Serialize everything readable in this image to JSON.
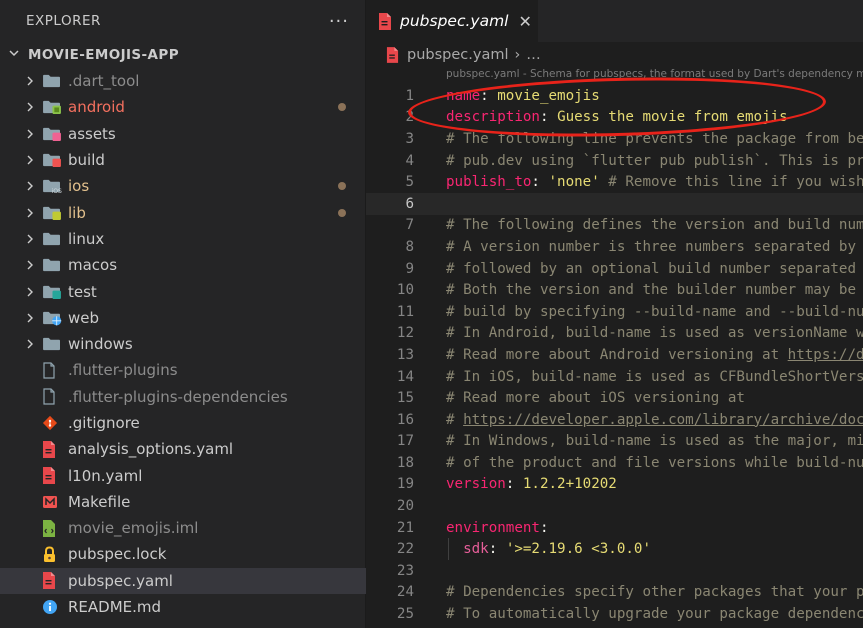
{
  "sidebar": {
    "title": "EXPLORER",
    "more_label": "···",
    "project": "MOVIE-EMOJIS-APP",
    "items": [
      {
        "name": ".dart_tool",
        "kind": "folder",
        "icon": "folder-icon",
        "color": "dim",
        "chevron": true,
        "dot": false
      },
      {
        "name": "android",
        "kind": "folder",
        "icon": "android-folder-icon",
        "color": "red",
        "chevron": true,
        "dot": true
      },
      {
        "name": "assets",
        "kind": "folder",
        "icon": "assets-folder-icon",
        "color": "default",
        "chevron": true,
        "dot": false
      },
      {
        "name": "build",
        "kind": "folder",
        "icon": "build-folder-icon",
        "color": "default",
        "chevron": true,
        "dot": false
      },
      {
        "name": "ios",
        "kind": "folder",
        "icon": "ios-folder-icon",
        "color": "yellow",
        "chevron": true,
        "dot": true
      },
      {
        "name": "lib",
        "kind": "folder",
        "icon": "lib-folder-icon",
        "color": "yellow",
        "chevron": true,
        "dot": true
      },
      {
        "name": "linux",
        "kind": "folder",
        "icon": "folder-icon",
        "color": "default",
        "chevron": true,
        "dot": false
      },
      {
        "name": "macos",
        "kind": "folder",
        "icon": "folder-icon",
        "color": "default",
        "chevron": true,
        "dot": false
      },
      {
        "name": "test",
        "kind": "folder",
        "icon": "test-folder-icon",
        "color": "default",
        "chevron": true,
        "dot": false
      },
      {
        "name": "web",
        "kind": "folder",
        "icon": "web-folder-icon",
        "color": "default",
        "chevron": true,
        "dot": false
      },
      {
        "name": "windows",
        "kind": "folder",
        "icon": "folder-icon",
        "color": "default",
        "chevron": true,
        "dot": false
      },
      {
        "name": ".flutter-plugins",
        "kind": "file",
        "icon": "file-icon",
        "color": "dim",
        "chevron": false,
        "dot": false
      },
      {
        "name": ".flutter-plugins-dependencies",
        "kind": "file",
        "icon": "file-icon",
        "color": "dim",
        "chevron": false,
        "dot": false
      },
      {
        "name": ".gitignore",
        "kind": "file",
        "icon": "git-icon",
        "color": "default",
        "chevron": false,
        "dot": false
      },
      {
        "name": "analysis_options.yaml",
        "kind": "file",
        "icon": "yaml-file-icon",
        "color": "default",
        "chevron": false,
        "dot": false
      },
      {
        "name": "l10n.yaml",
        "kind": "file",
        "icon": "yaml-file-icon",
        "color": "default",
        "chevron": false,
        "dot": false
      },
      {
        "name": "Makefile",
        "kind": "file",
        "icon": "makefile-icon",
        "color": "default",
        "chevron": false,
        "dot": false
      },
      {
        "name": "movie_emojis.iml",
        "kind": "file",
        "icon": "iml-file-icon",
        "color": "dim",
        "chevron": false,
        "dot": false
      },
      {
        "name": "pubspec.lock",
        "kind": "file",
        "icon": "lock-icon",
        "color": "default",
        "chevron": false,
        "dot": false
      },
      {
        "name": "pubspec.yaml",
        "kind": "file",
        "icon": "yaml-file-icon",
        "color": "default",
        "chevron": false,
        "dot": false,
        "selected": true
      },
      {
        "name": "README.md",
        "kind": "file",
        "icon": "info-icon",
        "color": "default",
        "chevron": false,
        "dot": false
      }
    ]
  },
  "editor": {
    "tab_label": "pubspec.yaml",
    "tab_close": "✕",
    "breadcrumb": {
      "file": "pubspec.yaml",
      "sep": "›",
      "more": "…"
    },
    "schema_hint": "pubspec.yaml - Schema for pubspecs, the format used by Dart's dependency manager",
    "current_line": 6,
    "lines": [
      {
        "n": "1",
        "tokens": [
          {
            "t": "name",
            "c": "key"
          },
          {
            "t": ": ",
            "c": "plain"
          },
          {
            "t": "movie_emojis",
            "c": "str"
          }
        ]
      },
      {
        "n": "2",
        "tokens": [
          {
            "t": "description",
            "c": "key"
          },
          {
            "t": ": ",
            "c": "plain"
          },
          {
            "t": "Guess the movie from emojis",
            "c": "str"
          }
        ]
      },
      {
        "n": "3",
        "tokens": [
          {
            "t": "# The following line prevents the package from being accidentally published to",
            "c": "com"
          }
        ]
      },
      {
        "n": "4",
        "tokens": [
          {
            "t": "# pub.dev using `flutter pub publish`. This is preferred for private packages.",
            "c": "com"
          }
        ]
      },
      {
        "n": "5",
        "tokens": [
          {
            "t": "publish_to",
            "c": "key"
          },
          {
            "t": ": ",
            "c": "plain"
          },
          {
            "t": "'none'",
            "c": "str"
          },
          {
            "t": " # Remove this line if you wish to publish to pub.dev",
            "c": "com"
          }
        ]
      },
      {
        "n": "6",
        "tokens": []
      },
      {
        "n": "7",
        "tokens": [
          {
            "t": "# The following defines the version and build number for your application.",
            "c": "com"
          }
        ]
      },
      {
        "n": "8",
        "tokens": [
          {
            "t": "# A version number is three numbers separated by dots, like 1.2.43",
            "c": "com"
          }
        ]
      },
      {
        "n": "9",
        "tokens": [
          {
            "t": "# followed by an optional build number separated by a +.",
            "c": "com"
          }
        ]
      },
      {
        "n": "10",
        "tokens": [
          {
            "t": "# Both the version and the builder number may be overridden in flutter",
            "c": "com"
          }
        ]
      },
      {
        "n": "11",
        "tokens": [
          {
            "t": "# build by specifying --build-name and --build-number, respectively.",
            "c": "com"
          }
        ]
      },
      {
        "n": "12",
        "tokens": [
          {
            "t": "# In Android, build-name is used as versionName while build-number used as versionCode.",
            "c": "com"
          }
        ]
      },
      {
        "n": "13",
        "tokens": [
          {
            "t": "# Read more about Android versioning at ",
            "c": "com"
          },
          {
            "t": "https://developer.android.com/studio/publish/versioning",
            "c": "link"
          }
        ]
      },
      {
        "n": "14",
        "tokens": [
          {
            "t": "# In iOS, build-name is used as CFBundleShortVersionString while build-number is used as CFBundleVersion.",
            "c": "com"
          }
        ]
      },
      {
        "n": "15",
        "tokens": [
          {
            "t": "# Read more about iOS versioning at",
            "c": "com"
          }
        ]
      },
      {
        "n": "16",
        "tokens": [
          {
            "t": "# ",
            "c": "com"
          },
          {
            "t": "https://developer.apple.com/library/archive/documentation/General/Reference/InfoPlistKeyReference/Articles/CoreFoundationKeys.html",
            "c": "link"
          }
        ]
      },
      {
        "n": "17",
        "tokens": [
          {
            "t": "# In Windows, build-name is used as the major, minor, and patch parts",
            "c": "com"
          }
        ]
      },
      {
        "n": "18",
        "tokens": [
          {
            "t": "# of the product and file versions while build-number is used as the build suffix.",
            "c": "com"
          }
        ]
      },
      {
        "n": "19",
        "tokens": [
          {
            "t": "version",
            "c": "key"
          },
          {
            "t": ": ",
            "c": "plain"
          },
          {
            "t": "1.2.2+10202",
            "c": "num"
          }
        ]
      },
      {
        "n": "20",
        "tokens": []
      },
      {
        "n": "21",
        "tokens": [
          {
            "t": "environment",
            "c": "key"
          },
          {
            "t": ":",
            "c": "plain"
          }
        ]
      },
      {
        "n": "22",
        "indent": true,
        "tokens": [
          {
            "t": "  sdk",
            "c": "key2"
          },
          {
            "t": ": ",
            "c": "plain"
          },
          {
            "t": "'>=2.19.6 <3.0.0'",
            "c": "str"
          }
        ]
      },
      {
        "n": "23",
        "tokens": []
      },
      {
        "n": "24",
        "tokens": [
          {
            "t": "# Dependencies specify other packages that your package needs in order to work.",
            "c": "com"
          }
        ]
      },
      {
        "n": "25",
        "tokens": [
          {
            "t": "# To automatically upgrade your package dependencies to the latest versions",
            "c": "com"
          }
        ]
      }
    ]
  },
  "colors": {
    "annotation": "#e8231a",
    "accent_red": "#f4705f",
    "modified_dot": "#8b7258"
  }
}
